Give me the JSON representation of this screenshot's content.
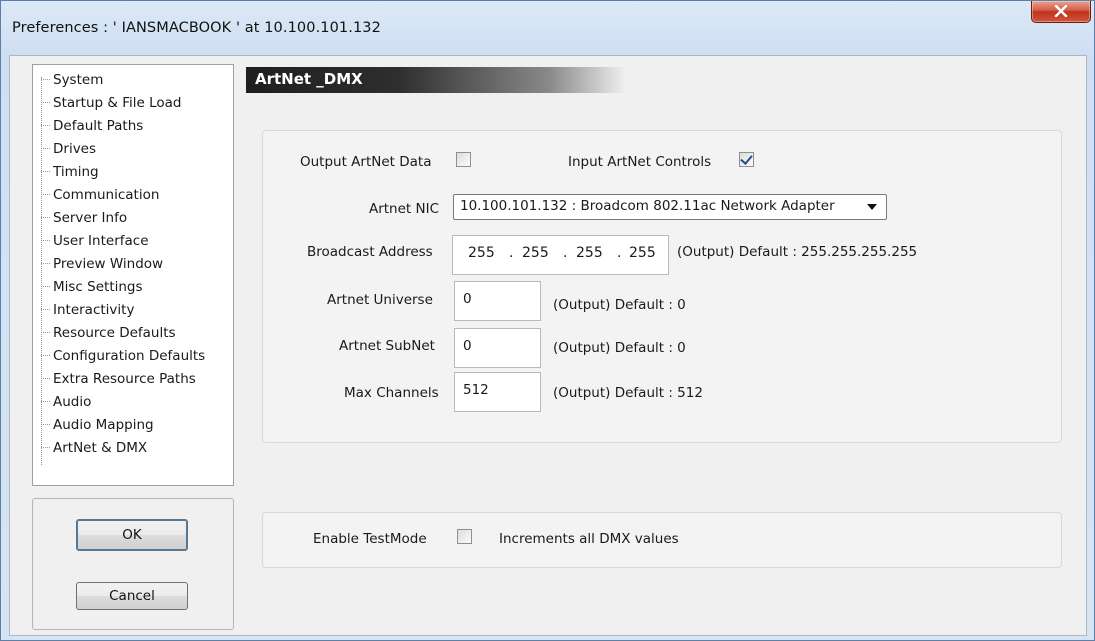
{
  "window": {
    "title": "Preferences  :  ' IANSMACBOOK '  at  10.100.101.132"
  },
  "sidebar": {
    "items": [
      {
        "label": "System"
      },
      {
        "label": "Startup & File Load"
      },
      {
        "label": "Default Paths"
      },
      {
        "label": "Drives"
      },
      {
        "label": "Timing"
      },
      {
        "label": "Communication"
      },
      {
        "label": "Server Info"
      },
      {
        "label": "User Interface"
      },
      {
        "label": "Preview Window"
      },
      {
        "label": "Misc Settings"
      },
      {
        "label": "Interactivity"
      },
      {
        "label": "Resource Defaults"
      },
      {
        "label": "Configuration Defaults"
      },
      {
        "label": "Extra Resource Paths"
      },
      {
        "label": "Audio"
      },
      {
        "label": "Audio Mapping"
      },
      {
        "label": "ArtNet & DMX"
      }
    ],
    "selected": "ArtNet & DMX"
  },
  "buttons": {
    "ok": "OK",
    "cancel": "Cancel"
  },
  "panel": {
    "title": "ArtNet _DMX",
    "output_artnet_label": "Output ArtNet Data",
    "output_artnet_checked": false,
    "input_artnet_label": "Input ArtNet Controls",
    "input_artnet_checked": true,
    "nic_label": "Artnet NIC",
    "nic_value": "10.100.101.132 : Broadcom 802.11ac Network Adapter",
    "broadcast_label": "Broadcast Address",
    "broadcast_octets": [
      "255",
      "255",
      "255",
      "255"
    ],
    "broadcast_dot": ".",
    "broadcast_default": "(Output) Default : 255.255.255.255",
    "universe_label": "Artnet Universe",
    "universe_value": "0",
    "universe_default": "(Output) Default : 0",
    "subnet_label": "Artnet SubNet",
    "subnet_value": "0",
    "subnet_default": "(Output) Default : 0",
    "max_channels_label": "Max Channels",
    "max_channels_value": "512",
    "max_channels_default": "(Output) Default : 512",
    "testmode_label": "Enable TestMode",
    "testmode_checked": false,
    "testmode_hint": "Increments all DMX values"
  },
  "colors": {
    "close_button": "#c7402a",
    "header_bg": "#222222",
    "header_text": "#ffffff",
    "checkbox_tick": "#2e4c8c"
  }
}
